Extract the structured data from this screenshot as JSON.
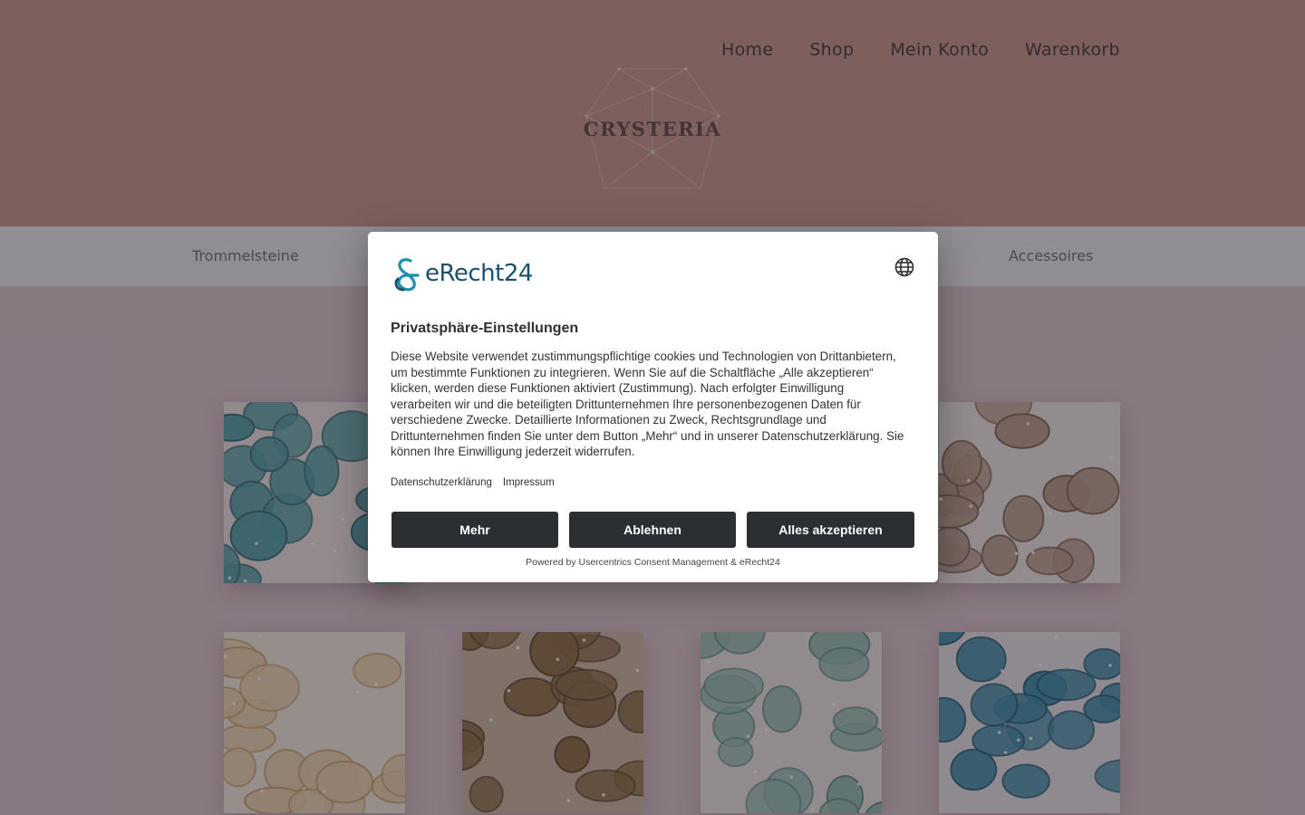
{
  "site": {
    "logo_text": "CRYSTERIA",
    "nav": [
      "Home",
      "Shop",
      "Mein Konto",
      "Warenkorb"
    ],
    "categories": [
      "Trommelsteine",
      "Accessoires"
    ]
  },
  "consent": {
    "brand_name": "eRecht24",
    "title": "Privatsphäre-Einstellungen",
    "body": "Diese Website verwendet zustimmungspflichtige cookies und Technologien von Drittanbietern, um bestimmte Funktionen zu integrieren. Wenn Sie auf die Schaltfläche „Alle akzeptieren“ klicken, werden diese Funktionen aktiviert (Zustimmung). Nach erfolgter Einwilligung verarbeiten wir und die beteiligten Drittunternehmen Ihre personenbezogenen Daten für verschiedene Zwecke. Detaillierte Informationen zu Zweck, Rechtsgrundlage und Drittunternehmen finden Sie unter dem Button „Mehr“ und in unserer Datenschutzerklärung. Sie können Ihre Einwilligung jederzeit widerrufen.",
    "links": [
      "Datenschutzerklärung",
      "Impressum"
    ],
    "buttons": {
      "more": "Mehr",
      "decline": "Ablehnen",
      "accept_all": "Alles akzeptieren"
    },
    "powered_by": "Powered by Usercentrics Consent Management & eRecht24"
  },
  "colors": {
    "header_bg": "#c39585",
    "category_bar_bg": "#e7e8ea",
    "button_bg": "#2b2f33",
    "brand_teal": "#1a4f72"
  },
  "tiles": [
    {
      "stone": "turquoise",
      "base": "#e9e2dc",
      "fill": "#4f9ea0",
      "edge": "#2f6d70"
    },
    {
      "stone": "moonstone",
      "base": "#ece6de",
      "fill": "#b59a83",
      "edge": "#7d6250"
    },
    {
      "stone": "citrine",
      "base": "#f1e9d9",
      "fill": "#e9d2a8",
      "edge": "#c9a56c"
    },
    {
      "stone": "tigereye",
      "base": "#c8b79a",
      "fill": "#8a6a3e",
      "edge": "#5a4428"
    },
    {
      "stone": "amazonite",
      "base": "#e7e4df",
      "fill": "#8fbcad",
      "edge": "#5f8f80"
    },
    {
      "stone": "apatite",
      "base": "#e2e2e0",
      "fill": "#3b8aa3",
      "edge": "#1e5c70"
    }
  ]
}
